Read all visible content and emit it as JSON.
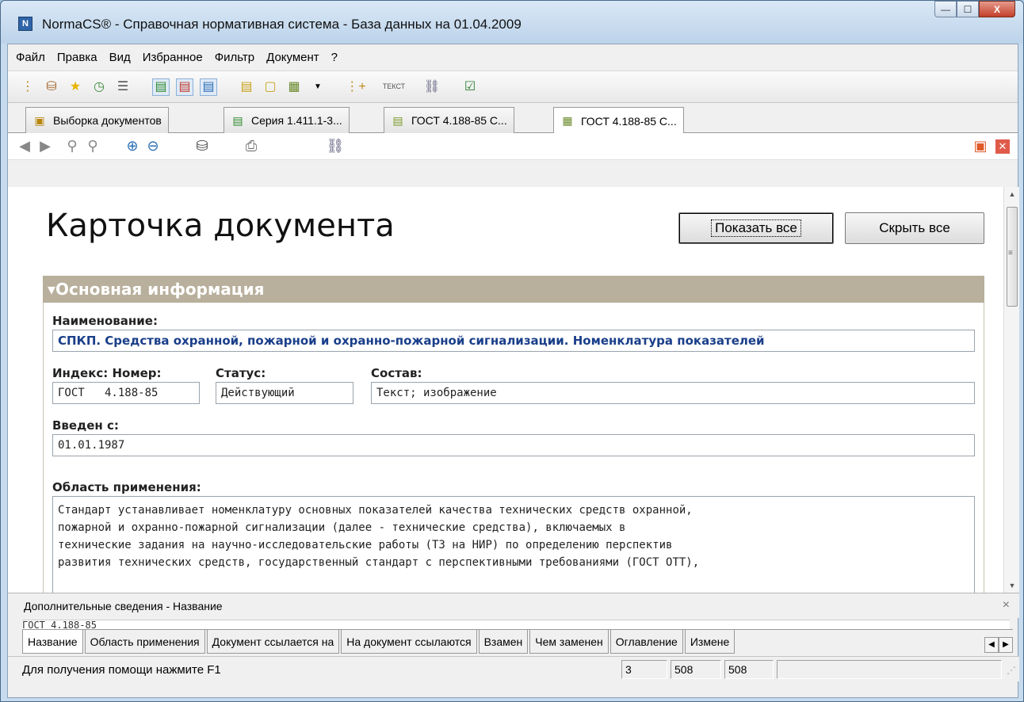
{
  "window": {
    "title": "NormaCS® - Справочная нормативная система - База данных на 01.04.2009",
    "app_icon": "N",
    "controls": {
      "minimize": "—",
      "maximize": "☐",
      "close": "X"
    }
  },
  "menu": [
    "Файл",
    "Правка",
    "Вид",
    "Избранное",
    "Фильтр",
    "Документ",
    "?"
  ],
  "toolbar_icons": [
    "tree-icon",
    "binoculars-icon",
    "star-icon",
    "history-icon",
    "list-icon",
    "doc-green-icon",
    "doc-red-icon",
    "doc-blue-icon",
    "doc-yellow-icon",
    "doc-copy-icon",
    "doc-dropdown-icon",
    "tree-add-icon",
    "text-icon",
    "link-icon",
    "check-doc-icon"
  ],
  "doc_tabs": [
    {
      "label": "Выборка документов",
      "icon": "folder-docs-icon"
    },
    {
      "label": "Серия 1.411.1-3...",
      "icon": "doc-green-icon"
    },
    {
      "label": "ГОСТ 4.188-85 С...",
      "icon": "doc-light-icon"
    },
    {
      "label": "ГОСТ 4.188-85 С...",
      "icon": "card-icon"
    }
  ],
  "card": {
    "title": "Карточка документа",
    "show_all": "Показать все",
    "hide_all": "Скрыть все",
    "section": "▾Основная информация",
    "name_label": "Наименование:",
    "name_value": "СПКП. Средства охранной, пожарной и охранно-пожарной сигнализации. Номенклатура показателей",
    "index_label": "Индекс: Номер:",
    "index_value": "ГОСТ   4.188-85",
    "status_label": "Статус:",
    "status_value": "Действующий",
    "composition_label": "Состав:",
    "composition_value": "Текст; изображение",
    "introduced_label": "Введен с:",
    "introduced_value": "01.01.1987",
    "scope_label": "Область применения:",
    "scope_value": "Стандарт устанавливает номенклатуру основных показателей качества технических средств охранной,\nпожарной и охранно-пожарной сигнализации (далее - технические средства), включаемых в\nтехнические задания на научно-исследовательские работы (ТЗ на НИР) по определению перспектив\nразвития технических средств, государственный стандарт с перспективными требованиями (ГОСТ ОТТ),"
  },
  "bottom_panel": {
    "header": "Дополнительные сведения - Название",
    "close": "×",
    "text": "ГОСТ 4.188-85",
    "tabs": [
      "Название",
      "Область применения",
      "Документ ссылается на",
      "На документ ссылаются",
      "Взамен",
      "Чем заменен",
      "Оглавление",
      "Измене"
    ],
    "active_tab": 0
  },
  "status": {
    "help": "Для получения помощи нажмите F1",
    "p1": "3",
    "p2": "508",
    "p3": "508"
  }
}
